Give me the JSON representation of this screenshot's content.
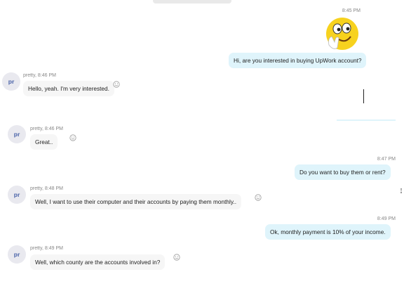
{
  "messages": {
    "m1": {
      "time": "8:45 PM",
      "emoji": "waving-face-emoji",
      "text": "Hi, are you interested in buying UpWork account?"
    },
    "m2": {
      "avatar": "pr",
      "sender": "pretty, 8:46 PM",
      "text": "Hello, yeah. I'm very interested."
    },
    "m3": {
      "avatar": "pr",
      "sender": "pretty, 8:46 PM",
      "text": "Great.."
    },
    "m4": {
      "time": "8:47 PM",
      "text": "Do you want to buy them or rent?"
    },
    "m5": {
      "avatar": "pr",
      "sender": "pretty, 8:48 PM",
      "text": "Well, I want to use their computer and their accounts by paying them monthly.."
    },
    "m6": {
      "time": "8:49 PM",
      "text": "Ok, monthly payment is 10% of your income."
    },
    "m7": {
      "avatar": "pr",
      "sender": "pretty, 8:49 PM",
      "text": "Well, which county are the accounts involved in?"
    }
  },
  "colors": {
    "outgoing_bubble": "#dff4fb",
    "incoming_bubble": "#f6f6f6",
    "avatar_bg": "#e9e9ef",
    "avatar_text": "#4a63a8",
    "emoji_face": "#f7d21e"
  }
}
